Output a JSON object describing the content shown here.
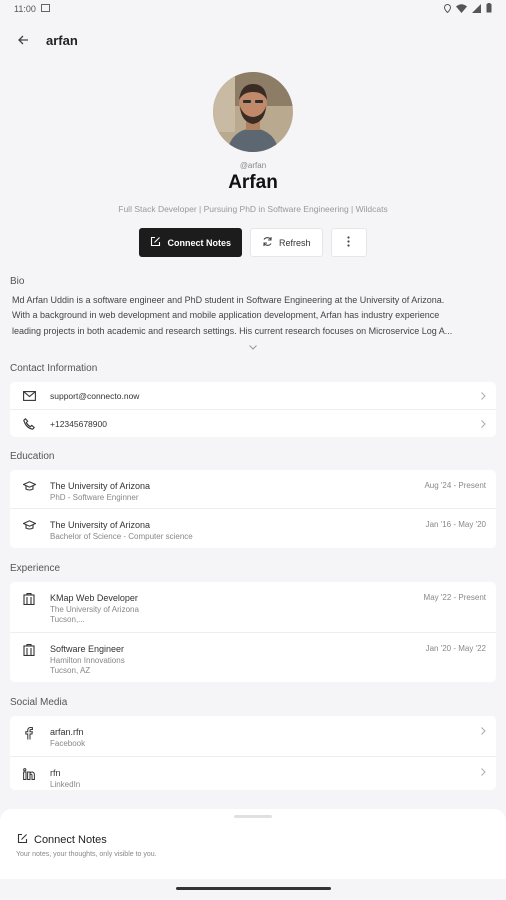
{
  "status_bar": {
    "time": "11:00"
  },
  "header": {
    "title": "arfan"
  },
  "profile": {
    "handle": "@arfan",
    "name": "Arfan",
    "tagline": "Full Stack Developer | Pursuing PhD in Software Engineering | Wildcats"
  },
  "actions": {
    "connect_notes": "Connect Notes",
    "refresh": "Refresh"
  },
  "bio": {
    "title": "Bio",
    "lines": [
      "Md Arfan Uddin is a software engineer and PhD student in Software Engineering at the University of Arizona.",
      "With a background in web development and mobile application development, Arfan has industry experience",
      "leading projects in both academic and research settings. His current research focuses on Microservice Log A..."
    ]
  },
  "contact": {
    "title": "Contact Information",
    "email": "support@connecto.now",
    "phone": "+12345678900"
  },
  "education": {
    "title": "Education",
    "items": [
      {
        "school": "The University of Arizona",
        "degree": "PhD - Software Enginner",
        "dates": "Aug '24 - Present"
      },
      {
        "school": "The University of Arizona",
        "degree": "Bachelor of Science - Computer science",
        "dates": "Jan '16 - May '20"
      }
    ]
  },
  "experience": {
    "title": "Experience",
    "items": [
      {
        "role": "KMap Web Developer",
        "org": "The University of Arizona",
        "location": "Tucson,...",
        "dates": "May '22 - Present"
      },
      {
        "role": "Software Engineer",
        "org": "Hamilton Innovations",
        "location": "Tucson, AZ",
        "dates": "Jan '20 - May '22"
      }
    ]
  },
  "social": {
    "title": "Social Media",
    "items": [
      {
        "handle": "arfan.rfn",
        "network": "Facebook"
      },
      {
        "handle": "rfn",
        "network": "LinkedIn"
      }
    ]
  },
  "bottom_sheet": {
    "title": "Connect Notes",
    "subtitle": "Your notes, your thoughts, only visible to you."
  }
}
